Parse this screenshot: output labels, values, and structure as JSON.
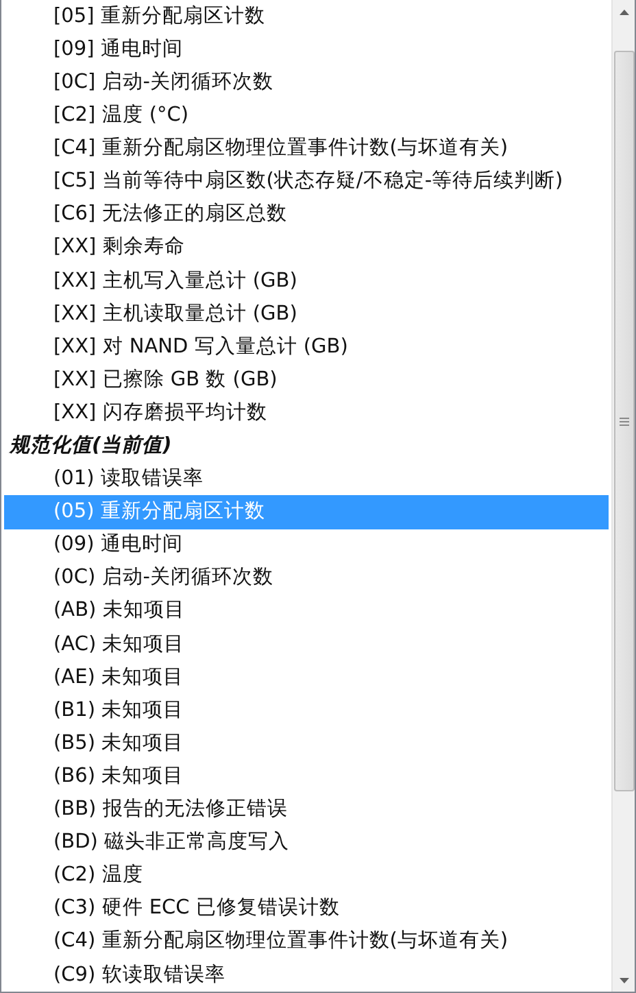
{
  "list": {
    "items": [
      {
        "kind": "option",
        "label": "[05] 重新分配扇区计数",
        "selected": false
      },
      {
        "kind": "option",
        "label": "[09] 通电时间",
        "selected": false
      },
      {
        "kind": "option",
        "label": "[0C] 启动-关闭循环次数",
        "selected": false
      },
      {
        "kind": "option",
        "label": "[C2] 温度 (°C)",
        "selected": false
      },
      {
        "kind": "option",
        "label": "[C4] 重新分配扇区物理位置事件计数(与坏道有关)",
        "selected": false
      },
      {
        "kind": "option",
        "label": "[C5] 当前等待中扇区数(状态存疑/不稳定-等待后续判断)",
        "selected": false
      },
      {
        "kind": "option",
        "label": "[C6] 无法修正的扇区总数",
        "selected": false
      },
      {
        "kind": "option",
        "label": "[XX] 剩余寿命",
        "selected": false
      },
      {
        "kind": "option",
        "label": "[XX] 主机写入量总计 (GB)",
        "selected": false
      },
      {
        "kind": "option",
        "label": "[XX] 主机读取量总计 (GB)",
        "selected": false
      },
      {
        "kind": "option",
        "label": "[XX] 对 NAND 写入量总计 (GB)",
        "selected": false
      },
      {
        "kind": "option",
        "label": "[XX] 已擦除 GB 数 (GB)",
        "selected": false
      },
      {
        "kind": "option",
        "label": "[XX] 闪存磨损平均计数",
        "selected": false
      },
      {
        "kind": "header",
        "label": "规范化值(当前值)"
      },
      {
        "kind": "option",
        "label": "(01) 读取错误率",
        "selected": false
      },
      {
        "kind": "option",
        "label": "(05) 重新分配扇区计数",
        "selected": true
      },
      {
        "kind": "option",
        "label": "(09) 通电时间",
        "selected": false
      },
      {
        "kind": "option",
        "label": "(0C) 启动-关闭循环次数",
        "selected": false
      },
      {
        "kind": "option",
        "label": "(AB) 未知项目",
        "selected": false
      },
      {
        "kind": "option",
        "label": "(AC) 未知项目",
        "selected": false
      },
      {
        "kind": "option",
        "label": "(AE) 未知项目",
        "selected": false
      },
      {
        "kind": "option",
        "label": "(B1) 未知项目",
        "selected": false
      },
      {
        "kind": "option",
        "label": "(B5) 未知项目",
        "selected": false
      },
      {
        "kind": "option",
        "label": "(B6) 未知项目",
        "selected": false
      },
      {
        "kind": "option",
        "label": "(BB) 报告的无法修正错误",
        "selected": false
      },
      {
        "kind": "option",
        "label": "(BD) 磁头非正常高度写入",
        "selected": false
      },
      {
        "kind": "option",
        "label": "(C2) 温度",
        "selected": false
      },
      {
        "kind": "option",
        "label": "(C3) 硬件 ECC 已修复错误计数",
        "selected": false
      },
      {
        "kind": "option",
        "label": "(C4) 重新分配扇区物理位置事件计数(与坏道有关)",
        "selected": false
      },
      {
        "kind": "option",
        "label": "(C9) 软读取错误率",
        "selected": false
      }
    ]
  }
}
